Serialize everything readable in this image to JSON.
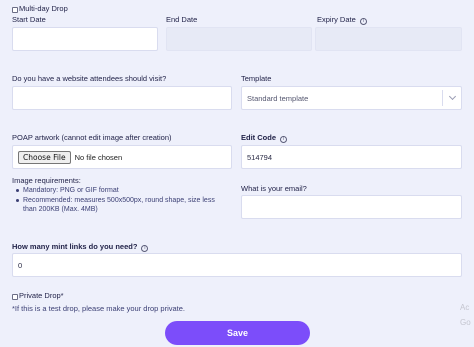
{
  "multi_day": {
    "label": "Multi-day Drop"
  },
  "dates": {
    "start_label": "Start Date",
    "end_label": "End Date",
    "expiry_label": "Expiry Date"
  },
  "website": {
    "label": "Do you have a website attendees should visit?",
    "value": ""
  },
  "template": {
    "label": "Template",
    "selected": "Standard template"
  },
  "artwork": {
    "label": "POAP artwork (cannot edit image after creation)",
    "button": "Choose File",
    "status": "No file chosen"
  },
  "edit_code": {
    "label": "Edit Code",
    "value": "514794"
  },
  "requirements": {
    "title": "Image requirements:",
    "items": [
      "Mandatory: PNG or GIF format",
      "Recommended: measures 500x500px, round shape, size less than 200KB (Max. 4MB)"
    ]
  },
  "email": {
    "label": "What is your email?",
    "value": ""
  },
  "mint_links": {
    "label": "How many mint links do you need?",
    "value": "0"
  },
  "private_drop": {
    "label": "Private Drop*",
    "note": "*If this is a test drop, please make your drop private."
  },
  "save": {
    "label": "Save"
  },
  "watermark": {
    "line1": "Ac",
    "line2": "Go"
  }
}
